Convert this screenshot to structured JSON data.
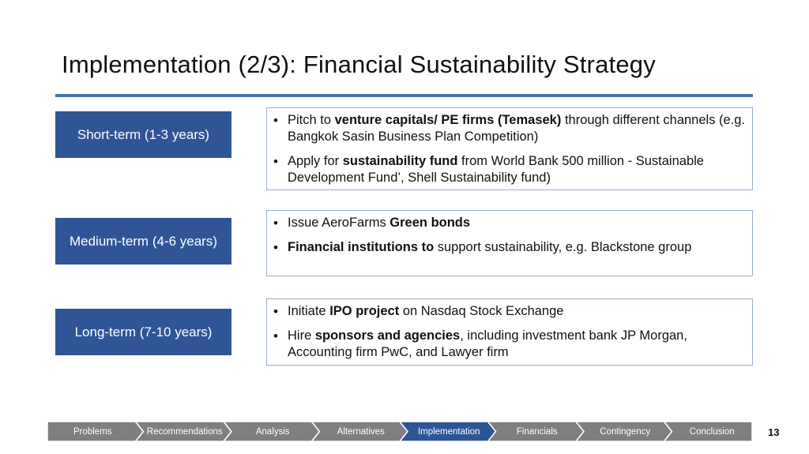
{
  "slide": {
    "title": "Implementation (2/3): Financial Sustainability Strategy",
    "page_number": "13",
    "accent_color": "#2f5597",
    "rule_color": "#4a72ad"
  },
  "phases": [
    {
      "label": "Short-term (1-3 years)",
      "bullets": [
        [
          {
            "text": "Pitch to ",
            "bold": false
          },
          {
            "text": "venture capitals/ PE firms (Temasek)",
            "bold": true
          },
          {
            "text": " through different channels (e.g. Bangkok Sasin Business Plan Competition)",
            "bold": false
          }
        ],
        [
          {
            "text": "Apply for ",
            "bold": false
          },
          {
            "text": "sustainability fund",
            "bold": true
          },
          {
            "text": " from World Bank 500 million - Sustainable Development Fund’, Shell Sustainability fund)",
            "bold": false
          }
        ]
      ]
    },
    {
      "label": "Medium-term (4-6 years)",
      "bullets": [
        [
          {
            "text": "Issue AeroFarms ",
            "bold": false
          },
          {
            "text": "Green bonds",
            "bold": true
          }
        ],
        [
          {
            "text": "Financial institutions to",
            "bold": true
          },
          {
            "text": " support sustainability, e.g. Blackstone group",
            "bold": false
          }
        ]
      ]
    },
    {
      "label": "Long-term (7-10 years)",
      "bullets": [
        [
          {
            "text": "Initiate ",
            "bold": false
          },
          {
            "text": "IPO project",
            "bold": true
          },
          {
            "text": " on Nasdaq Stock Exchange",
            "bold": false
          }
        ],
        [
          {
            "text": "Hire ",
            "bold": false
          },
          {
            "text": "sponsors and agencies",
            "bold": true
          },
          {
            "text": ", including investment bank JP Morgan, Accounting firm PwC, and Lawyer firm",
            "bold": false
          }
        ]
      ]
    }
  ],
  "nav": {
    "items": [
      "Problems",
      "Recommendations",
      "Analysis",
      "Alternatives",
      "Implementation",
      "Financials",
      "Contingency",
      "Conclusion"
    ],
    "active": "Implementation",
    "colors": {
      "default": "#7f7f7f",
      "active": "#2f5597",
      "separator": "#ffffff"
    }
  }
}
